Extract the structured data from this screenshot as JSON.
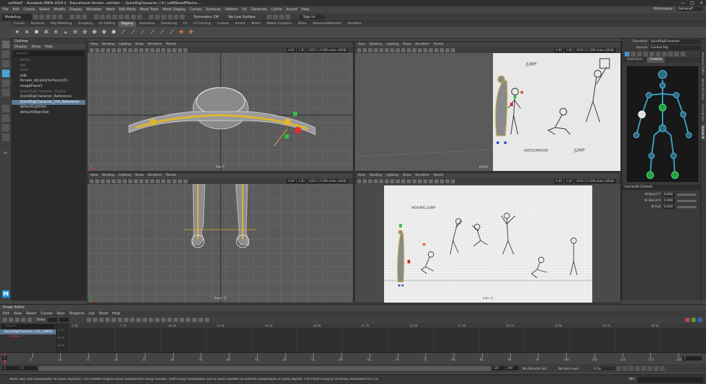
{
  "window": {
    "title": "untitled* - Autodesk MAYA 2024.2 - Educational Version: untitled   ---   QuickRigCharacter_Ctrl_LeftElbowEffector...",
    "controls": [
      "—",
      "□",
      "✕"
    ]
  },
  "menubar": [
    "File",
    "Edit",
    "Create",
    "Select",
    "Modify",
    "Display",
    "Windows",
    "Mesh",
    "Edit Mesh",
    "Mesh Tools",
    "Mesh Display",
    "Curves",
    "Surfaces",
    "Deform",
    "UV",
    "Generate",
    "Cache",
    "Arnold",
    "Help"
  ],
  "workspace": {
    "label": "Workspace :",
    "value": "General*"
  },
  "statusline": {
    "mode": "Modeling",
    "symmetry": "Symmetry: Off",
    "live_surface": "No Live Surface",
    "signin": "Sign In"
  },
  "shelf": {
    "tabs": [
      "Curves",
      "Surfaces",
      "Poly Modeling",
      "Sculpting",
      "UV Editing",
      "Rigging",
      "Animation",
      "Rendering",
      "FX",
      "FX Caching",
      "Custom",
      "Arnold",
      "MASH",
      "Motion Graphics",
      "XGen",
      "AdvancedSkeleton",
      "Deadline"
    ],
    "active": "Rigging"
  },
  "outliner": {
    "title": "Outliner",
    "menu": [
      "Display",
      "Show",
      "Help"
    ],
    "search_placeholder": "Search...",
    "items": [
      {
        "label": "persp",
        "dim": true,
        "sel": false
      },
      {
        "label": "top",
        "dim": true,
        "sel": false
      },
      {
        "label": "front",
        "dim": true,
        "sel": false
      },
      {
        "label": "side",
        "dim": false,
        "sel": false
      },
      {
        "label": "female_obj:polySurface1(0)",
        "dim": false,
        "sel": false
      },
      {
        "label": "imagePlane1",
        "dim": false,
        "sel": false
      },
      {
        "label": "QuickRigCharacter_Guides",
        "dim": true,
        "sel": false
      },
      {
        "label": "QuickRigCharacter_Reference",
        "dim": false,
        "sel": false
      },
      {
        "label": "QuickRigCharacter_Ctrl_Reference",
        "dim": false,
        "sel": true
      },
      {
        "label": "defaultLightSet",
        "dim": false,
        "sel": false
      },
      {
        "label": "defaultObjectSet",
        "dim": false,
        "sel": false
      }
    ]
  },
  "viewports": {
    "menu": [
      "View",
      "Shading",
      "Lighting",
      "Show",
      "Renderer",
      "Panels"
    ],
    "field_a": "0.00",
    "field_b": "1.00",
    "colorspace": "ACES 1.0 SDR-video (sRGB)",
    "labels": [
      "top -Y",
      "persp",
      "front -Z",
      "side -X"
    ],
    "sketch_notes": [
      "JUMP",
      "ANTICIPATION",
      "JUMP",
      "MOVING JUMP"
    ]
  },
  "character_panel": {
    "character_label": "Character:",
    "character_value": "QuickRigCharacter",
    "source_label": "Source:",
    "source_value": "Control Rig",
    "tabs": [
      "Definition",
      "Controls"
    ],
    "active_tab": "Controls",
    "side_tabs": [
      "Modeling Toolkit",
      "Attribute Editor",
      "Channel Box",
      "Human IK"
    ]
  },
  "humanik_controls": {
    "title": "HumanIK Controls",
    "rows": [
      {
        "label": "IK Blend T",
        "value": "0.000"
      },
      {
        "label": "IK Blend R",
        "value": "0.000"
      },
      {
        "label": "IK Pull",
        "value": "0.000"
      }
    ]
  },
  "graph_editor": {
    "title": "Graph Editor",
    "menu": [
      "Edit",
      "View",
      "Select",
      "Curves",
      "Keys",
      "Tangents",
      "List",
      "Show",
      "Help"
    ],
    "stats": "Stats",
    "search_placeholder": "Search...",
    "items": [
      "QuickRigCharacter_Ctrl_LeftElb",
      "Rotate Y"
    ],
    "ruler": [
      "3.30",
      "7.70",
      "10.50",
      "13.30",
      "16.10",
      "18.90",
      "21.70",
      "24.50",
      "27.30",
      "30.10",
      "32.90",
      "35.70",
      "38.50"
    ],
    "rulerB": [
      "-0.70",
      "21.00",
      "24.00",
      "27.00",
      "30.00"
    ]
  },
  "time_slider": {
    "ticks": [
      "5",
      "10",
      "15",
      "20",
      "25",
      "30",
      "35",
      "40",
      "45",
      "50",
      "55",
      "60",
      "65",
      "70",
      "75",
      "80",
      "85",
      "90",
      "95",
      "100",
      "105",
      "110",
      "115",
      "120"
    ],
    "current": "1",
    "range_start": "1",
    "range_min": "1",
    "range_end": "120",
    "range_max": "200",
    "fps": "24 fps",
    "no_character_set": "No Character Set",
    "no_anim_layer": "No Anim Layer",
    "current_field": "1"
  },
  "help_line": {
    "text": "Move Tool: Use manipulator to move object(s). Ctrl+middle drag to move components along normals. Shift+drag manipulator axis or plane handles to extrude components or clone objects. Ctrl+Shift+drag to constrain movement to a co",
    "mel": "MEL"
  }
}
